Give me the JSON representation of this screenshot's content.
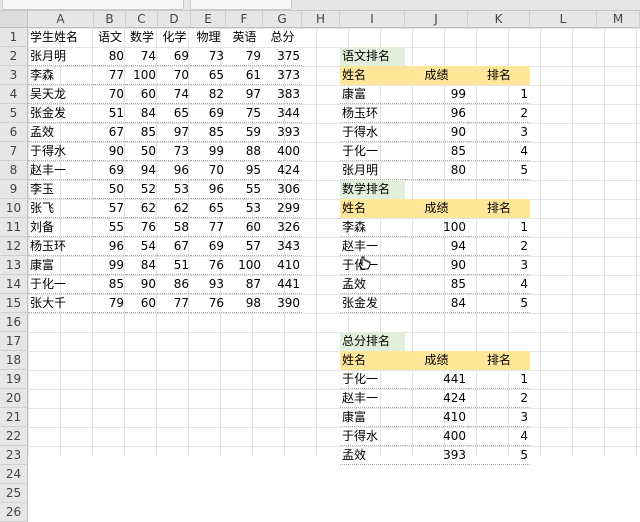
{
  "columns": [
    "A",
    "B",
    "C",
    "D",
    "E",
    "F",
    "G",
    "H",
    "I",
    "J",
    "K",
    "L",
    "M"
  ],
  "rows": [
    "1",
    "2",
    "3",
    "4",
    "5",
    "6",
    "7",
    "8",
    "9",
    "10",
    "11",
    "12",
    "13",
    "14",
    "15",
    "16",
    "17",
    "18",
    "19",
    "20",
    "21",
    "22",
    "23",
    "24",
    "25",
    "26"
  ],
  "main_table": {
    "headers": [
      "学生姓名",
      "语文",
      "数学",
      "化学",
      "物理",
      "英语",
      "总分"
    ],
    "data": [
      [
        "张月明",
        "80",
        "74",
        "69",
        "73",
        "79",
        "375"
      ],
      [
        "李森",
        "77",
        "100",
        "70",
        "65",
        "61",
        "373"
      ],
      [
        "吴天龙",
        "70",
        "60",
        "74",
        "82",
        "97",
        "383"
      ],
      [
        "张金发",
        "51",
        "84",
        "65",
        "69",
        "75",
        "344"
      ],
      [
        "孟效",
        "67",
        "85",
        "97",
        "85",
        "59",
        "393"
      ],
      [
        "于得水",
        "90",
        "50",
        "73",
        "99",
        "88",
        "400"
      ],
      [
        "赵丰一",
        "69",
        "94",
        "96",
        "70",
        "95",
        "424"
      ],
      [
        "李玉",
        "50",
        "52",
        "53",
        "96",
        "55",
        "306"
      ],
      [
        "张飞",
        "57",
        "62",
        "62",
        "65",
        "53",
        "299"
      ],
      [
        "刘备",
        "55",
        "76",
        "58",
        "77",
        "60",
        "326"
      ],
      [
        "杨玉环",
        "96",
        "54",
        "67",
        "69",
        "57",
        "343"
      ],
      [
        "康富",
        "99",
        "84",
        "51",
        "76",
        "100",
        "410"
      ],
      [
        "于化一",
        "85",
        "90",
        "86",
        "93",
        "87",
        "441"
      ],
      [
        "张大千",
        "79",
        "60",
        "77",
        "76",
        "98",
        "390"
      ]
    ]
  },
  "rank_tables": [
    {
      "title": "语文排名",
      "headers": [
        "姓名",
        "成绩",
        "排名"
      ],
      "data": [
        [
          "康富",
          "99",
          "1"
        ],
        [
          "杨玉环",
          "96",
          "2"
        ],
        [
          "于得水",
          "90",
          "3"
        ],
        [
          "于化一",
          "85",
          "4"
        ],
        [
          "张月明",
          "80",
          "5"
        ]
      ]
    },
    {
      "title": "数学排名",
      "headers": [
        "姓名",
        "成绩",
        "排名"
      ],
      "data": [
        [
          "李森",
          "100",
          "1"
        ],
        [
          "赵丰一",
          "94",
          "2"
        ],
        [
          "于化一",
          "90",
          "3"
        ],
        [
          "孟效",
          "85",
          "4"
        ],
        [
          "张金发",
          "84",
          "5"
        ]
      ]
    },
    {
      "title": "总分排名",
      "headers": [
        "姓名",
        "成绩",
        "排名"
      ],
      "data": [
        [
          "于化一",
          "441",
          "1"
        ],
        [
          "赵丰一",
          "424",
          "2"
        ],
        [
          "康富",
          "410",
          "3"
        ],
        [
          "于得水",
          "400",
          "4"
        ],
        [
          "孟效",
          "393",
          "5"
        ]
      ]
    }
  ],
  "colors": {
    "title_fill": "#e2efda",
    "header_fill": "#ffe699",
    "grid": "#e4e4e4",
    "header_bg": "#e6e6e6"
  },
  "icons": {
    "cursor": "hand-pointer-icon"
  }
}
